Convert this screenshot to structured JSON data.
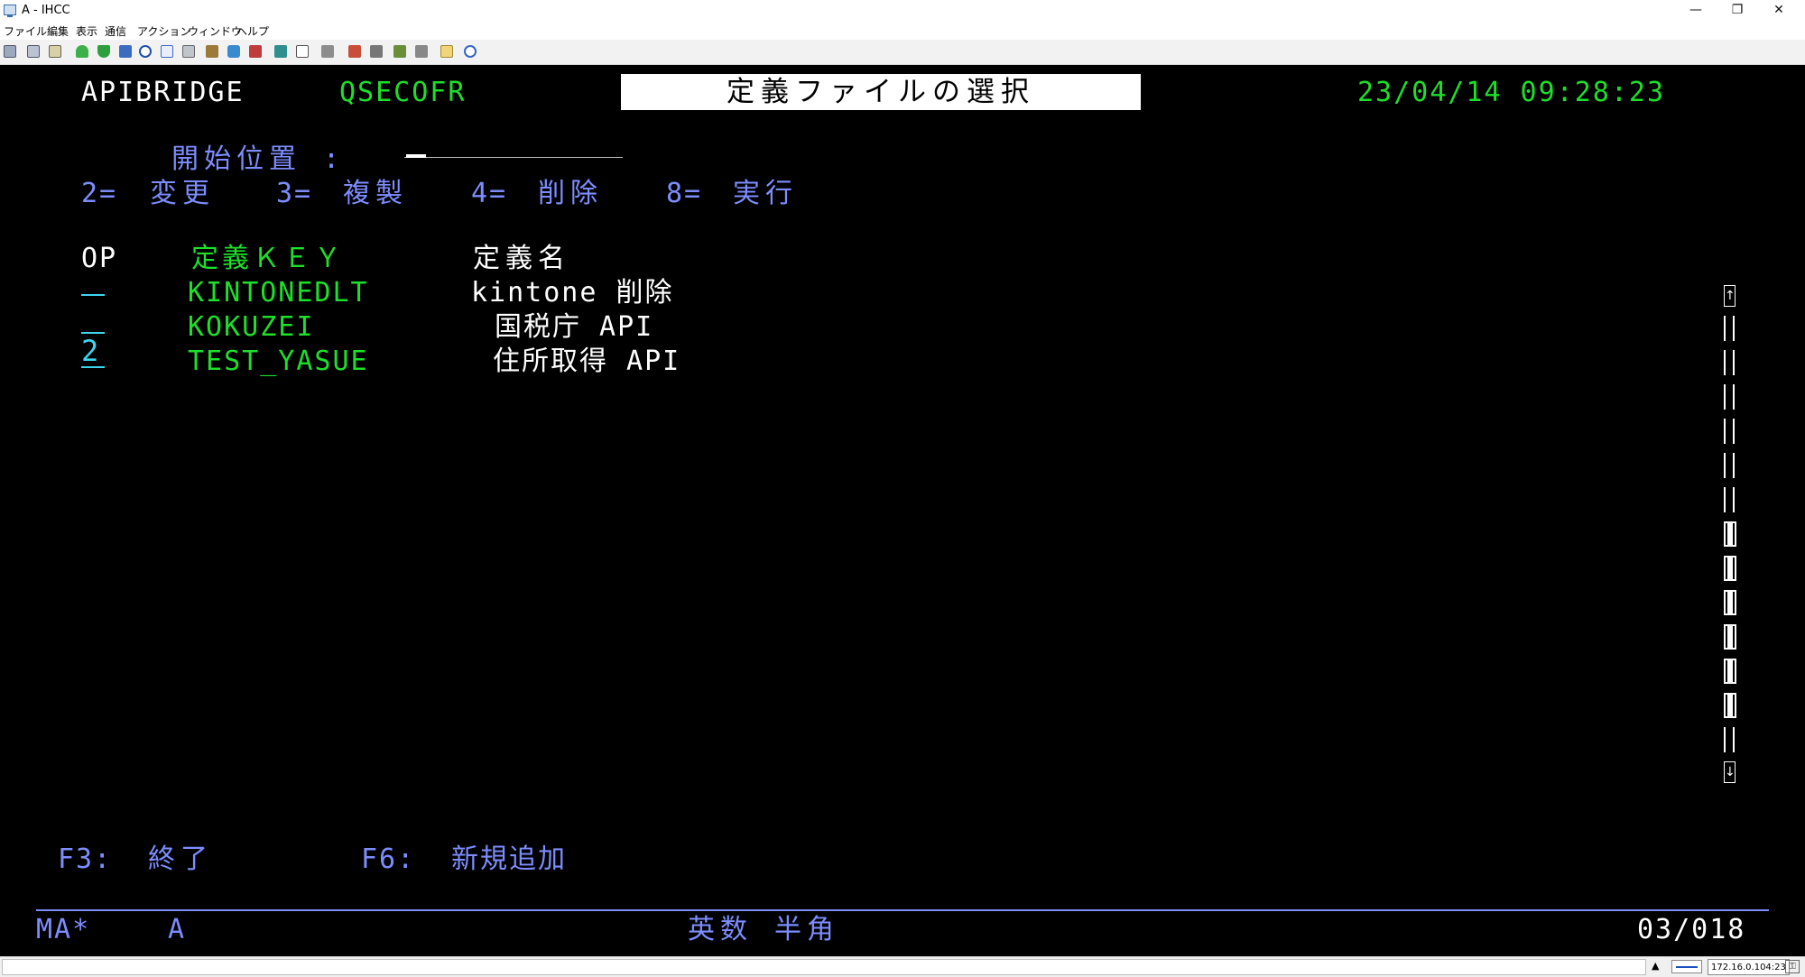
{
  "window": {
    "title": "A - IHCC",
    "controls": {
      "minimize": "—",
      "restore": "❐",
      "close": "✕"
    }
  },
  "menu": [
    "ファイル",
    "編集",
    "表示",
    "通信",
    "アクション",
    "ウィンドウ",
    "ヘルプ"
  ],
  "terminal": {
    "system": "APIBRIDGE",
    "user": "QSECOFR",
    "screen_title": "定義ファイルの選択",
    "datetime": "23/04/14 09:28:23",
    "start_position_label": "開始位置 :",
    "options": [
      {
        "key": "2=",
        "label": "変更"
      },
      {
        "key": "3=",
        "label": "複製"
      },
      {
        "key": "4=",
        "label": "削除"
      },
      {
        "key": "8=",
        "label": "実行"
      }
    ],
    "columns": {
      "op": "OP",
      "key": "定義ＫＥＹ",
      "name": "定義名"
    },
    "rows": [
      {
        "op": "",
        "key": "KINTONEDLT",
        "name": "kintone 削除"
      },
      {
        "op": "",
        "key": "KOKUZEI",
        "name": "国税庁 API"
      },
      {
        "op": "2",
        "key": "TEST_YASUE",
        "name": "住所取得 API"
      }
    ],
    "function_keys": [
      {
        "key": "F3:",
        "label": "終了"
      },
      {
        "key": "F6:",
        "label": "新規追加"
      }
    ],
    "status": {
      "left": "MA*",
      "session": "A",
      "input_mode": "英数 半角",
      "cursor_pos": "03/018"
    }
  },
  "statusbar": {
    "ip": "172.16.0.104:23",
    "up_arrow": "▲"
  },
  "colors": {
    "screen_bg": "#000000",
    "green": "#1edf2b",
    "blue": "#7d8dff",
    "cyan": "#3ed6ee",
    "white": "#ffffff"
  }
}
